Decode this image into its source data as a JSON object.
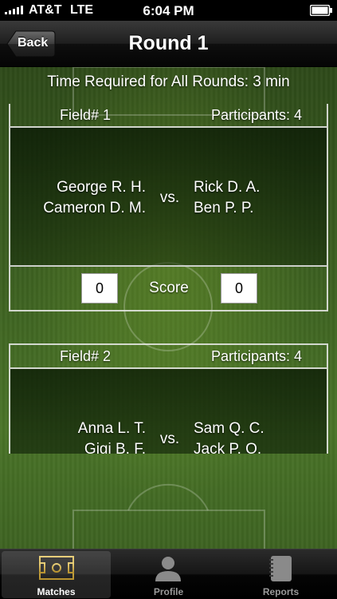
{
  "status_bar": {
    "carrier": "AT&T",
    "network": "LTE",
    "time": "6:04 PM"
  },
  "nav": {
    "title": "Round 1",
    "back_label": "Back"
  },
  "summary": {
    "time_required": "Time Required for All Rounds: 3 min"
  },
  "matches": [
    {
      "field": "Field# 1",
      "participants": "Participants: 4",
      "team_left": [
        "George R. H.",
        "Cameron D. M."
      ],
      "team_right": [
        "Rick D. A.",
        "Ben P. P."
      ],
      "vs": "vs.",
      "score_label": "Score",
      "score_left": "0",
      "score_right": "0"
    },
    {
      "field": "Field# 2",
      "participants": "Participants: 4",
      "team_left": [
        "Anna L. T.",
        "Gigi B. F."
      ],
      "team_right": [
        "Sam Q. C.",
        "Jack P. O."
      ],
      "vs": "vs."
    }
  ],
  "tabs": [
    {
      "label": "Matches",
      "icon": "soccer-field-icon",
      "active": true
    },
    {
      "label": "Profile",
      "icon": "person-silhouette-icon",
      "active": false
    },
    {
      "label": "Reports",
      "icon": "notebook-icon",
      "active": false
    }
  ],
  "colors": {
    "grass": "#3d6121",
    "field_line": "#ebebeb",
    "nav_bar": "#1e1e1e",
    "tab_active_label": "#ffffff",
    "tab_inactive_label": "#9a9a9a"
  }
}
